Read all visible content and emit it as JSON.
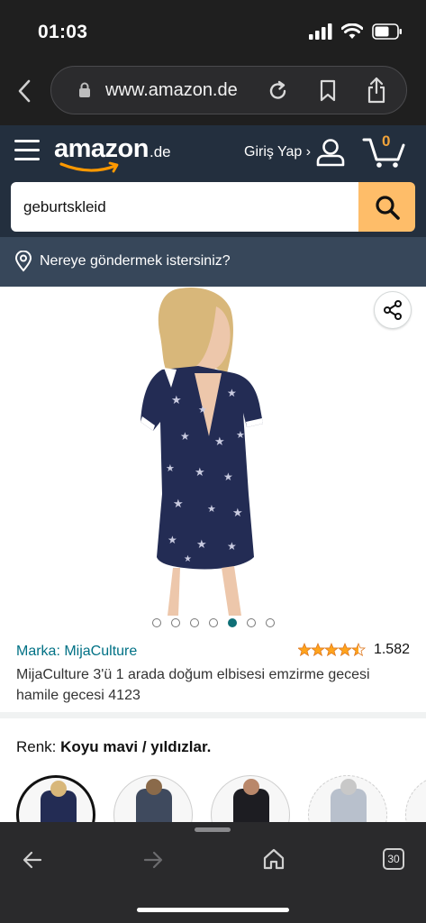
{
  "status_bar": {
    "time": "01:03"
  },
  "browser": {
    "url": "www.amazon.de",
    "tab_count": "30"
  },
  "header": {
    "logo_text": "amazon",
    "logo_tld": ".de",
    "signin_label": "Giriş Yap ›",
    "cart_count": "0"
  },
  "search": {
    "value": "geburtskleid"
  },
  "location": {
    "label": "Nereye göndermek istersiniz?"
  },
  "gallery": {
    "image_count": 7,
    "active_index": 4
  },
  "product": {
    "brand": "Marka: MijaCulture",
    "rating_stars": 4.5,
    "rating_count": "1.582",
    "title": "MijaCulture 3'ü 1 arada doğum elbisesi emzirme gecesi hamile gecesi 4123"
  },
  "variant": {
    "color_label": "Renk:",
    "color_value": "Koyu mavi / yıldızlar."
  },
  "colors": {
    "accent": "#febd69",
    "header_bg": "#232f3e",
    "location_bg": "#37475a",
    "link": "#007185",
    "dress_navy": "#232c54"
  }
}
